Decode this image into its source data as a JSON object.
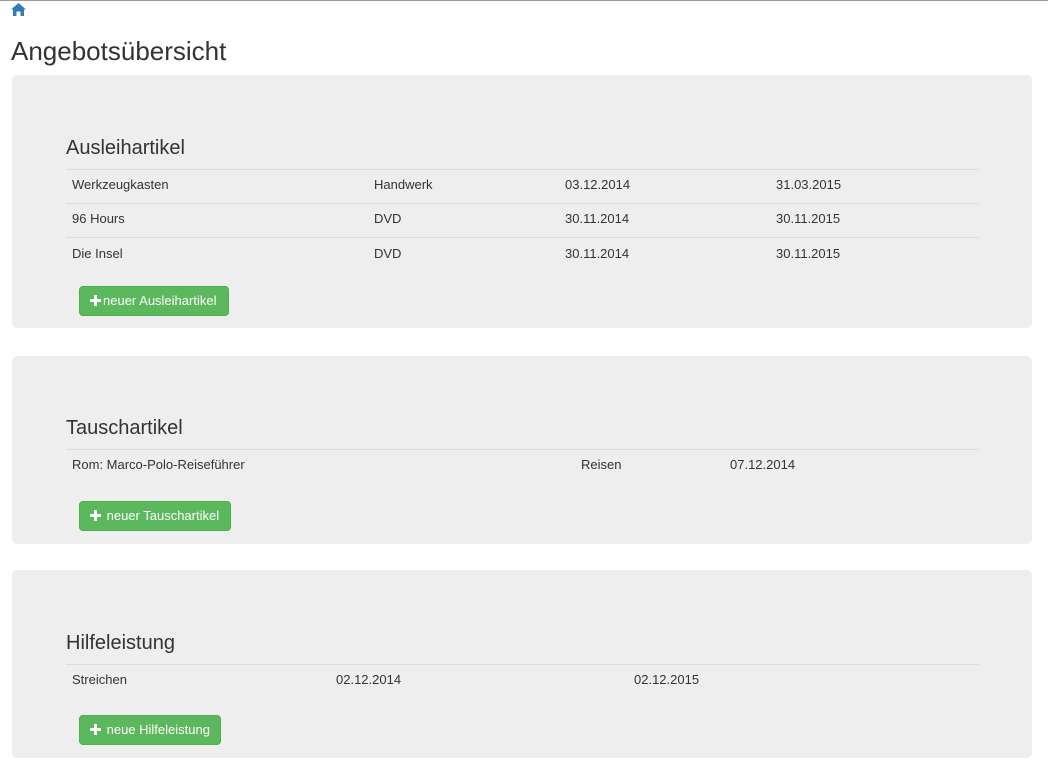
{
  "header": {
    "home_icon": "home-icon",
    "title": "Angebotsübersicht"
  },
  "colors": {
    "panel_bg": "#eeeeee",
    "button_green": "#5cb85c",
    "link_blue": "#337ab7"
  },
  "sections": [
    {
      "title": "Ausleihartikel",
      "rows": [
        [
          "Werkzeugkasten",
          "Handwerk",
          "03.12.2014",
          "31.03.2015"
        ],
        [
          "96 Hours",
          "DVD",
          "30.11.2014",
          "30.11.2015"
        ],
        [
          "Die Insel",
          "DVD",
          "30.11.2014",
          "30.11.2015"
        ]
      ],
      "button_label": "neuer Ausleihartikel",
      "button_icon": "plus-icon"
    },
    {
      "title": "Tauschartikel",
      "rows": [
        [
          "Rom: Marco-Polo-Reiseführer",
          "Reisen",
          "07.12.2014"
        ]
      ],
      "button_label": " neuer Tauschartikel",
      "button_icon": "plus-icon"
    },
    {
      "title": "Hilfeleistung",
      "rows": [
        [
          "Streichen",
          "02.12.2014",
          "02.12.2015"
        ]
      ],
      "button_label": " neue Hilfeleistung",
      "button_icon": "plus-icon"
    }
  ]
}
